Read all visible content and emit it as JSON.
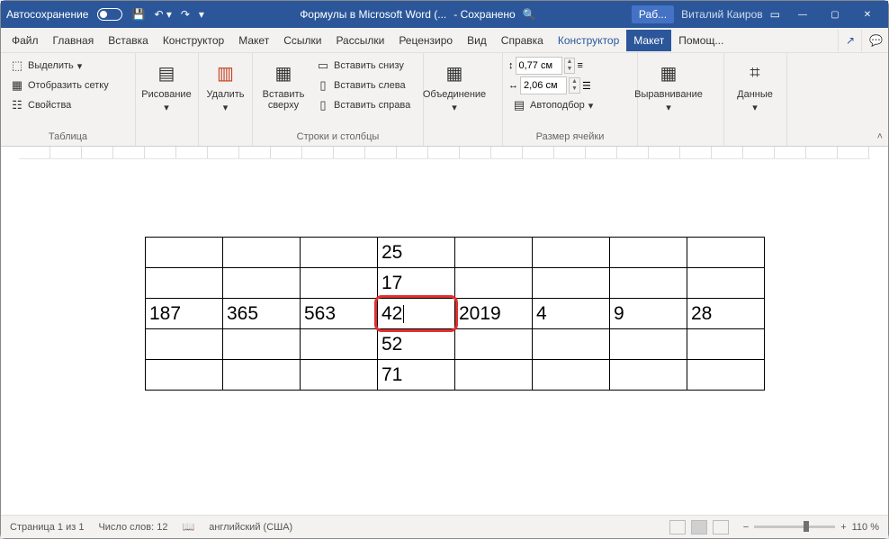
{
  "title": {
    "autosave": "Автосохранение",
    "docname": "Формулы в Microsoft Word (...",
    "saved": "- Сохранено",
    "tab_context": "Раб...",
    "user": "Виталий Каиров"
  },
  "menu": {
    "file": "Файл",
    "home": "Главная",
    "insert": "Вставка",
    "constructor": "Конструктор",
    "layout": "Макет",
    "refs": "Ссылки",
    "mail": "Рассылки",
    "review": "Рецензиро",
    "view": "Вид",
    "help": "Справка",
    "tbldesign": "Конструктор",
    "tbllayout": "Макет",
    "tellme": "Помощ..."
  },
  "ribbon": {
    "table": {
      "select": "Выделить",
      "grid": "Отобразить сетку",
      "props": "Свойства",
      "group": "Таблица"
    },
    "draw": {
      "label": "Рисование"
    },
    "del": {
      "label": "Удалить"
    },
    "ins": {
      "above": "Вставить сверху",
      "below": "Вставить снизу",
      "left": "Вставить слева",
      "right": "Вставить справа",
      "group": "Строки и столбцы"
    },
    "merge": {
      "label": "Объединение"
    },
    "size": {
      "h": "0,77 см",
      "w": "2,06 см",
      "auto": "Автоподбор",
      "group": "Размер ячейки"
    },
    "align": {
      "label": "Выравнивание"
    },
    "data": {
      "label": "Данные"
    }
  },
  "table_data": {
    "rows": [
      [
        "",
        "",
        "",
        "25",
        "",
        "",
        "",
        ""
      ],
      [
        "",
        "",
        "",
        "17",
        "",
        "",
        "",
        ""
      ],
      [
        "187",
        "365",
        "563",
        "42",
        "2019",
        "4",
        "9",
        "28"
      ],
      [
        "",
        "",
        "",
        "52",
        "",
        "",
        "",
        ""
      ],
      [
        "",
        "",
        "",
        "71",
        "",
        "",
        "",
        ""
      ]
    ],
    "highlight": {
      "row": 2,
      "col": 3
    }
  },
  "status": {
    "page": "Страница 1 из 1",
    "words": "Число слов: 12",
    "lang": "английский (США)",
    "zoom": "110 %"
  }
}
